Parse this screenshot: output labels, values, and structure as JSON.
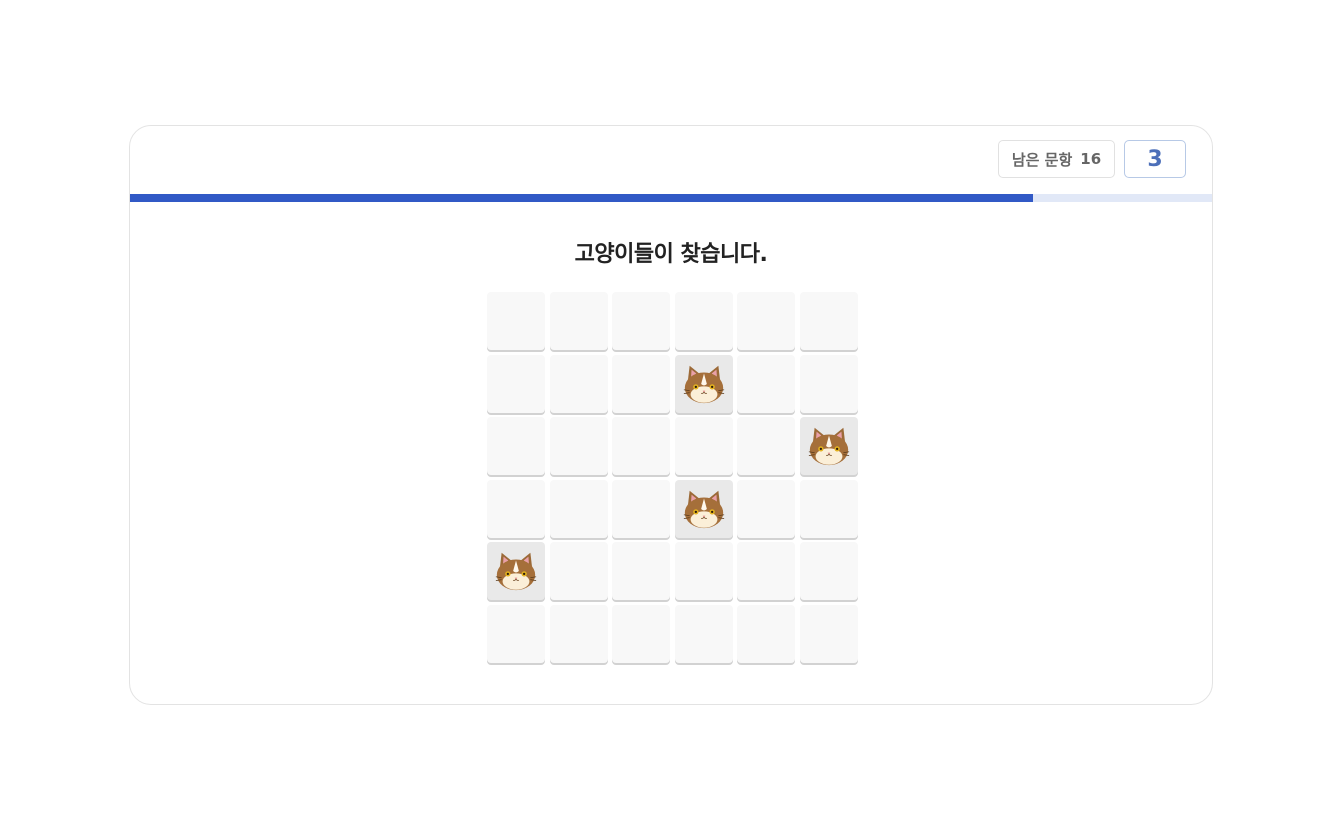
{
  "header": {
    "remaining_label": "남은 문항",
    "remaining_count": "16",
    "level": "3"
  },
  "progress": {
    "fraction": 0.835
  },
  "instruction": "고양이들이 찾습니다.",
  "grid": {
    "rows": 6,
    "cols": 6,
    "tile_icon": "cat-face-icon",
    "cats": [
      [
        1,
        3
      ],
      [
        2,
        5
      ],
      [
        3,
        3
      ],
      [
        4,
        0
      ]
    ]
  },
  "colors": {
    "progress_fill": "#3159c6",
    "progress_track": "#e1e8f7",
    "level_text": "#4c6fb9",
    "tile": "#f8f8f8",
    "tile_with_cat": "#e9e9e9"
  }
}
